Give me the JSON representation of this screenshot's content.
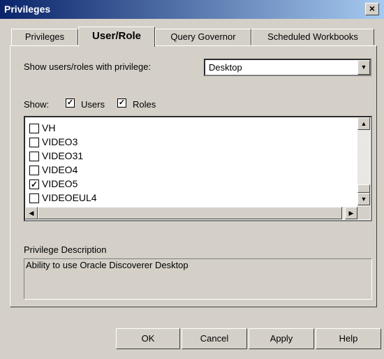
{
  "window": {
    "title": "Privileges",
    "close": "×"
  },
  "tabs": [
    "Privileges",
    "User/Role",
    "Query Governor",
    "Scheduled Workbooks"
  ],
  "show_privilege": {
    "label": "Show users/roles with privilege:",
    "selected": "Desktop"
  },
  "show": {
    "label": "Show:",
    "users": {
      "label": "Users",
      "checked": true
    },
    "roles": {
      "label": "Roles",
      "checked": true
    }
  },
  "list": [
    {
      "name": "VH",
      "checked": false
    },
    {
      "name": "VIDEO3",
      "checked": false
    },
    {
      "name": "VIDEO31",
      "checked": false
    },
    {
      "name": "VIDEO4",
      "checked": false
    },
    {
      "name": "VIDEO5",
      "checked": true
    },
    {
      "name": "VIDEOEUL4",
      "checked": false
    }
  ],
  "description": {
    "label": "Privilege Description",
    "text": "Ability to use Oracle Discoverer Desktop"
  },
  "buttons": {
    "ok": "OK",
    "cancel": "Cancel",
    "apply": "Apply",
    "help": "Help"
  }
}
